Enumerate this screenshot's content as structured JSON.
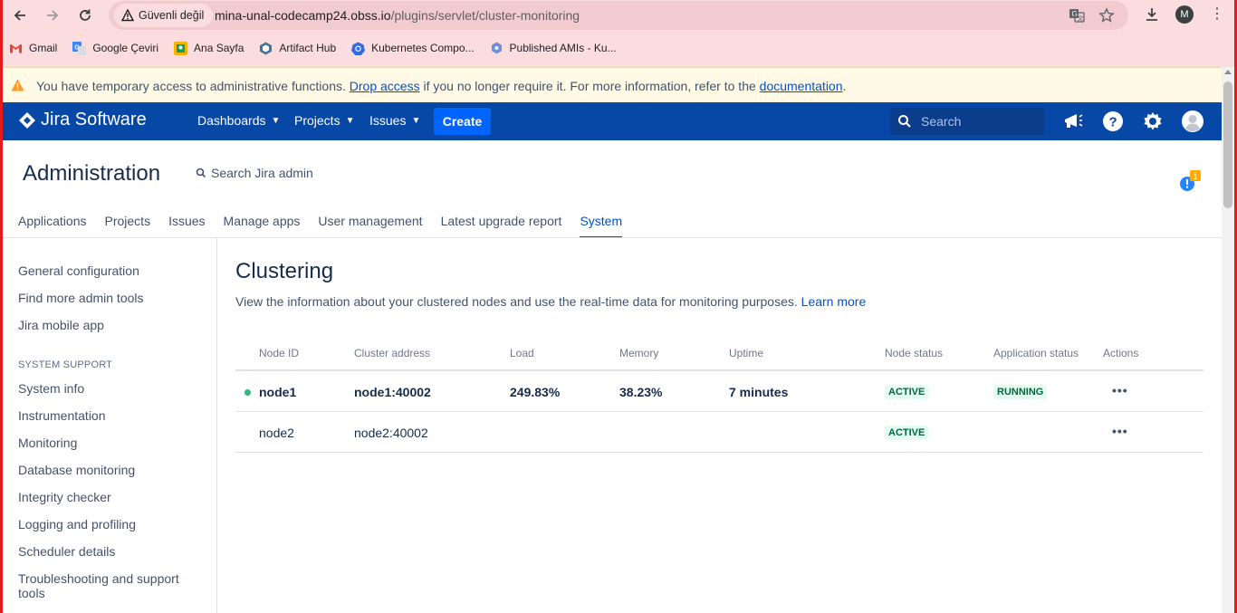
{
  "browser": {
    "security_label": "Güvenli değil",
    "url_host": "mina-unal-codecamp24.obss.io",
    "url_path": "/plugins/servlet/cluster-monitoring",
    "profile_initial": "M",
    "bookmarks": [
      {
        "label": "Gmail",
        "icon": "gmail-icon"
      },
      {
        "label": "Google Çeviri",
        "icon": "translate-icon"
      },
      {
        "label": "Ana Sayfa",
        "icon": "home-icon"
      },
      {
        "label": "Artifact Hub",
        "icon": "artifact-hub-icon"
      },
      {
        "label": "Kubernetes Compo...",
        "icon": "kubernetes-icon"
      },
      {
        "label": "Published AMIs - Ku...",
        "icon": "ami-icon"
      }
    ]
  },
  "banner": {
    "text_before": "You have temporary access to administrative functions. ",
    "link1": "Drop access",
    "text_middle": " if you no longer require it. For more information, refer to the ",
    "link2": "documentation",
    "text_after": "."
  },
  "header": {
    "logo": "Jira Software",
    "nav": [
      "Dashboards",
      "Projects",
      "Issues"
    ],
    "create": "Create",
    "search_placeholder": "Search"
  },
  "admin": {
    "title": "Administration",
    "search": "Search Jira admin",
    "notification_count": "1",
    "tabs": [
      "Applications",
      "Projects",
      "Issues",
      "Manage apps",
      "User management",
      "Latest upgrade report",
      "System"
    ]
  },
  "sidebar": {
    "top_items": [
      "General configuration",
      "Find more admin tools",
      "Jira mobile app"
    ],
    "section_heading": "SYSTEM SUPPORT",
    "items": [
      "System info",
      "Instrumentation",
      "Monitoring",
      "Database monitoring",
      "Integrity checker",
      "Logging and profiling",
      "Scheduler details",
      "Troubleshooting and support",
      "tools"
    ]
  },
  "main": {
    "title": "Clustering",
    "description": "View the information about your clustered nodes and use the real-time data for monitoring purposes. ",
    "learn_more": "Learn more",
    "columns": [
      "Node ID",
      "Cluster address",
      "Load",
      "Memory",
      "Uptime",
      "Node status",
      "Application status",
      "Actions"
    ],
    "rows": [
      {
        "node_id": "node1",
        "address": "node1:40002",
        "load": "249.83%",
        "memory": "38.23%",
        "uptime": "7 minutes",
        "node_status": "ACTIVE",
        "app_status": "RUNNING",
        "actions": "•••"
      },
      {
        "node_id": "node2",
        "address": "node2:40002",
        "load": "",
        "memory": "",
        "uptime": "",
        "node_status": "ACTIVE",
        "app_status": "",
        "actions": "•••"
      }
    ]
  },
  "colors": {
    "header_bg": "#0747a6",
    "create_bg": "#0065ff",
    "link": "#0052cc",
    "active_lozenge_bg": "#e3fcef",
    "active_lozenge_fg": "#006644",
    "banner_bg": "#fffae6",
    "browser_bg": "#fbdde0"
  }
}
